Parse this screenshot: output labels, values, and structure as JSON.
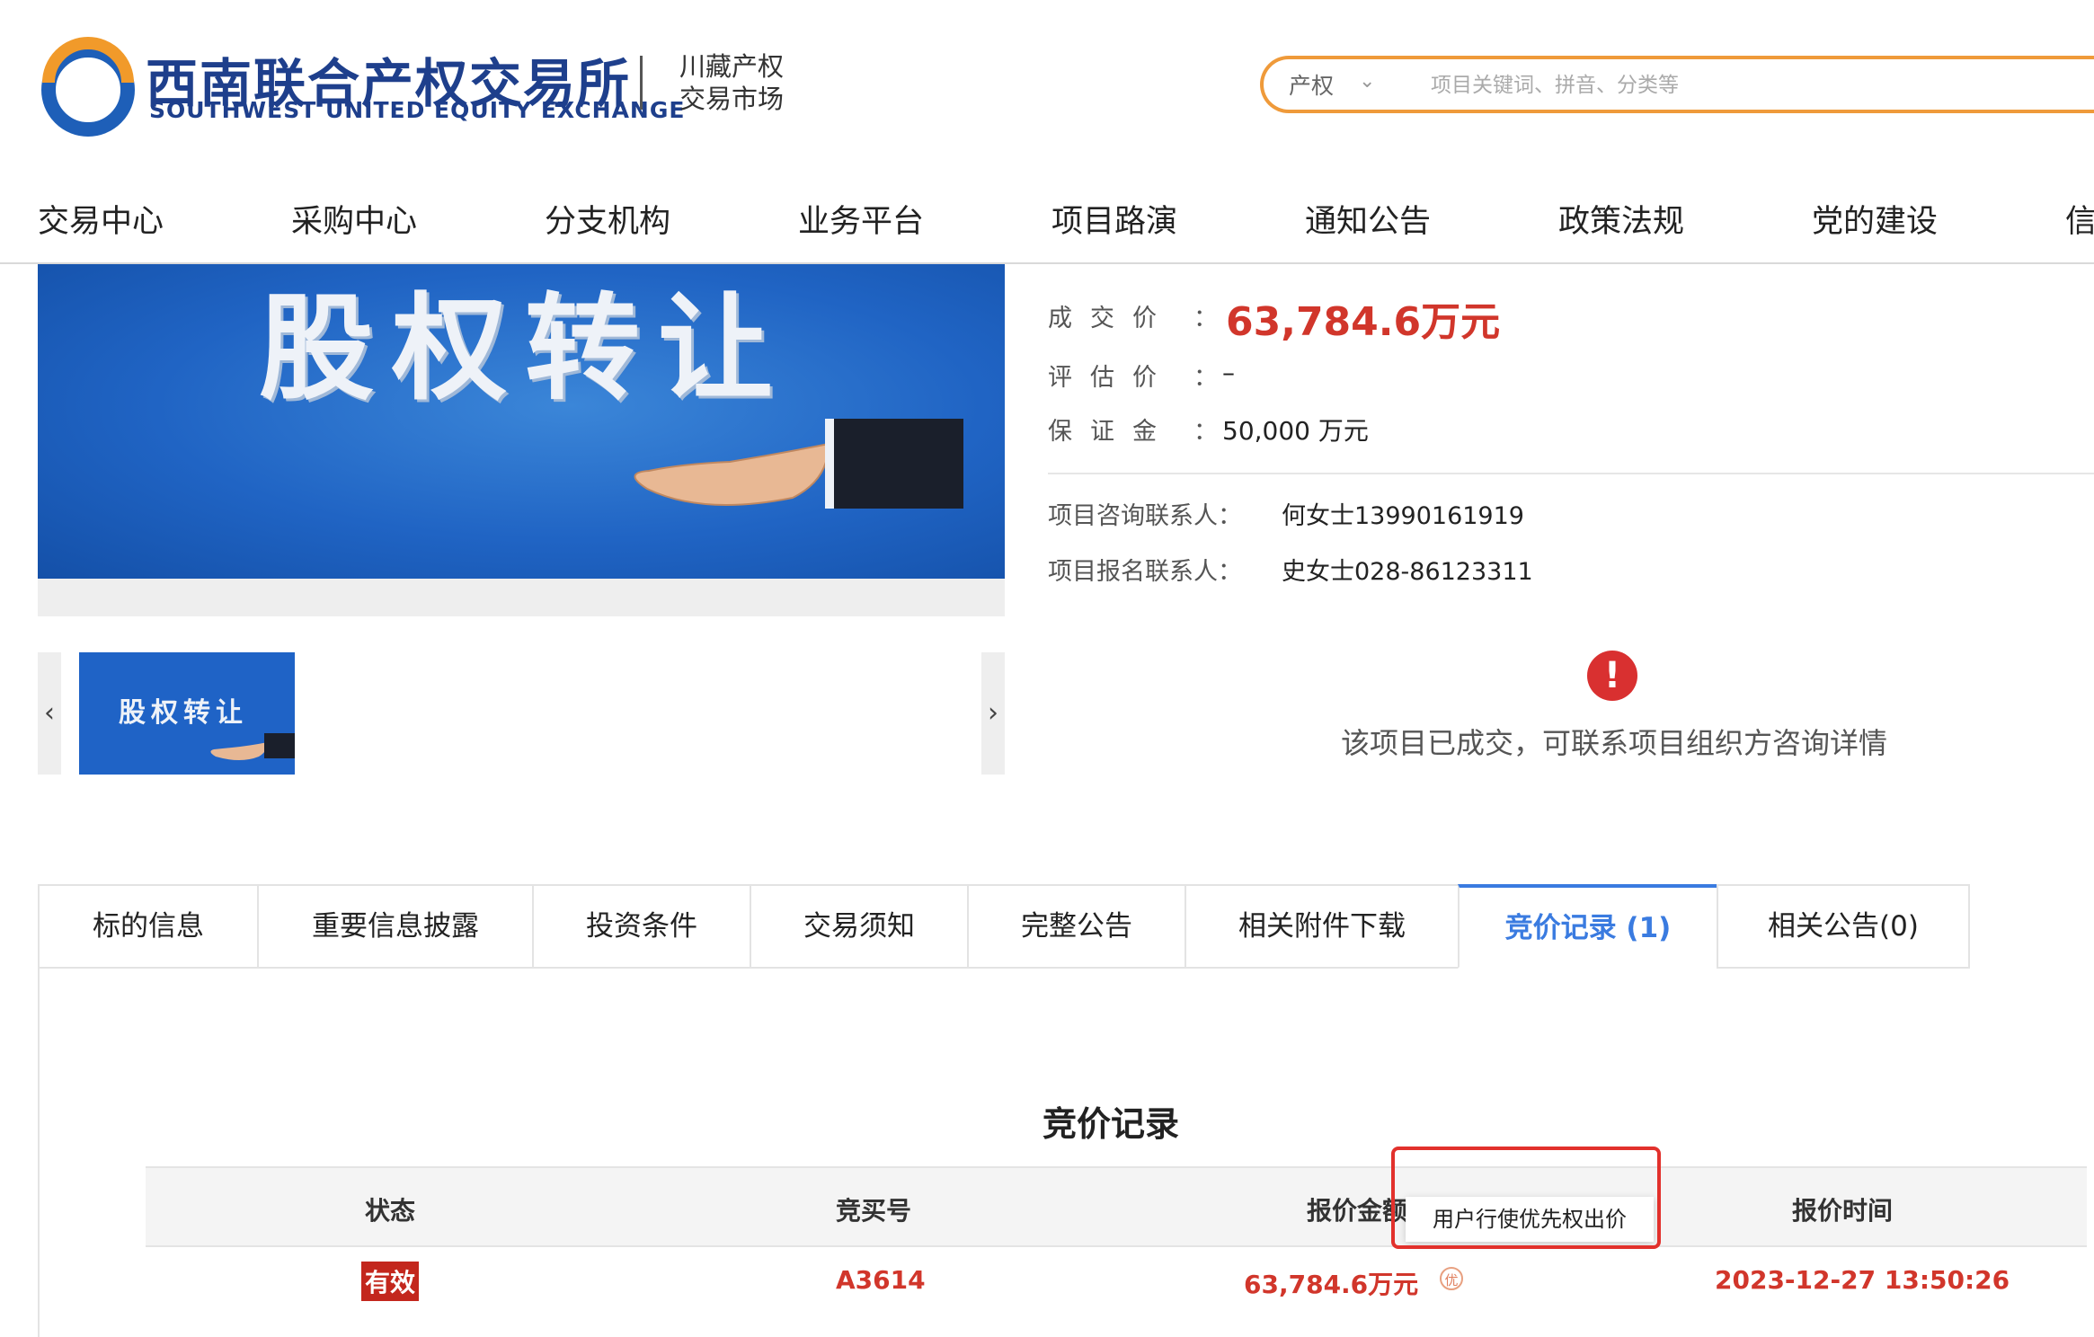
{
  "header": {
    "brand_cn": "西南联合产权交易所",
    "brand_en": "SOUTHWEST UNITED EQUITY EXCHANGE",
    "market_line1": "川藏产权",
    "market_line2": "交易市场",
    "search_category": "产权",
    "search_placeholder": "项目关键词、拼音、分类等"
  },
  "nav": [
    "交易中心",
    "采购中心",
    "分支机构",
    "业务平台",
    "项目路演",
    "通知公告",
    "政策法规",
    "党的建设",
    "信"
  ],
  "banner": {
    "text": "股权转让",
    "thumb_text": "股权转让"
  },
  "info": {
    "deal_price_label": "成交价",
    "deal_price_value": "63,784.6万元",
    "eval_price_label": "评估价",
    "eval_price_value": "–",
    "deposit_label": "保证金",
    "deposit_value": "50,000 万元",
    "colon": "：",
    "consult_label": "项目咨询联系人：",
    "consult_value": "何女士13990161919",
    "signup_label": "项目报名联系人：",
    "signup_value": "史女士028-86123311"
  },
  "alert": {
    "icon": "!",
    "text": "该项目已成交，可联系项目组织方咨询详情"
  },
  "tabs": [
    "标的信息",
    "重要信息披露",
    "投资条件",
    "交易须知",
    "完整公告",
    "相关附件下载",
    "竞价记录 (1)",
    "相关公告(0)"
  ],
  "records": {
    "title": "竞价记录",
    "columns": [
      "状态",
      "竞买号",
      "报价金额",
      "报价时间"
    ],
    "rows": [
      {
        "status": "有效",
        "bid_no": "A3614",
        "amount": "63,784.6万元",
        "priority_icon": "优",
        "time": "2023-12-27 13:50:26"
      }
    ],
    "tooltip": "用户行使优先权出价"
  },
  "colors": {
    "accent": "#3a7be0",
    "price_red": "#d1362b",
    "search_border": "#ef9a3a",
    "brand_blue": "#1e3f8c"
  }
}
